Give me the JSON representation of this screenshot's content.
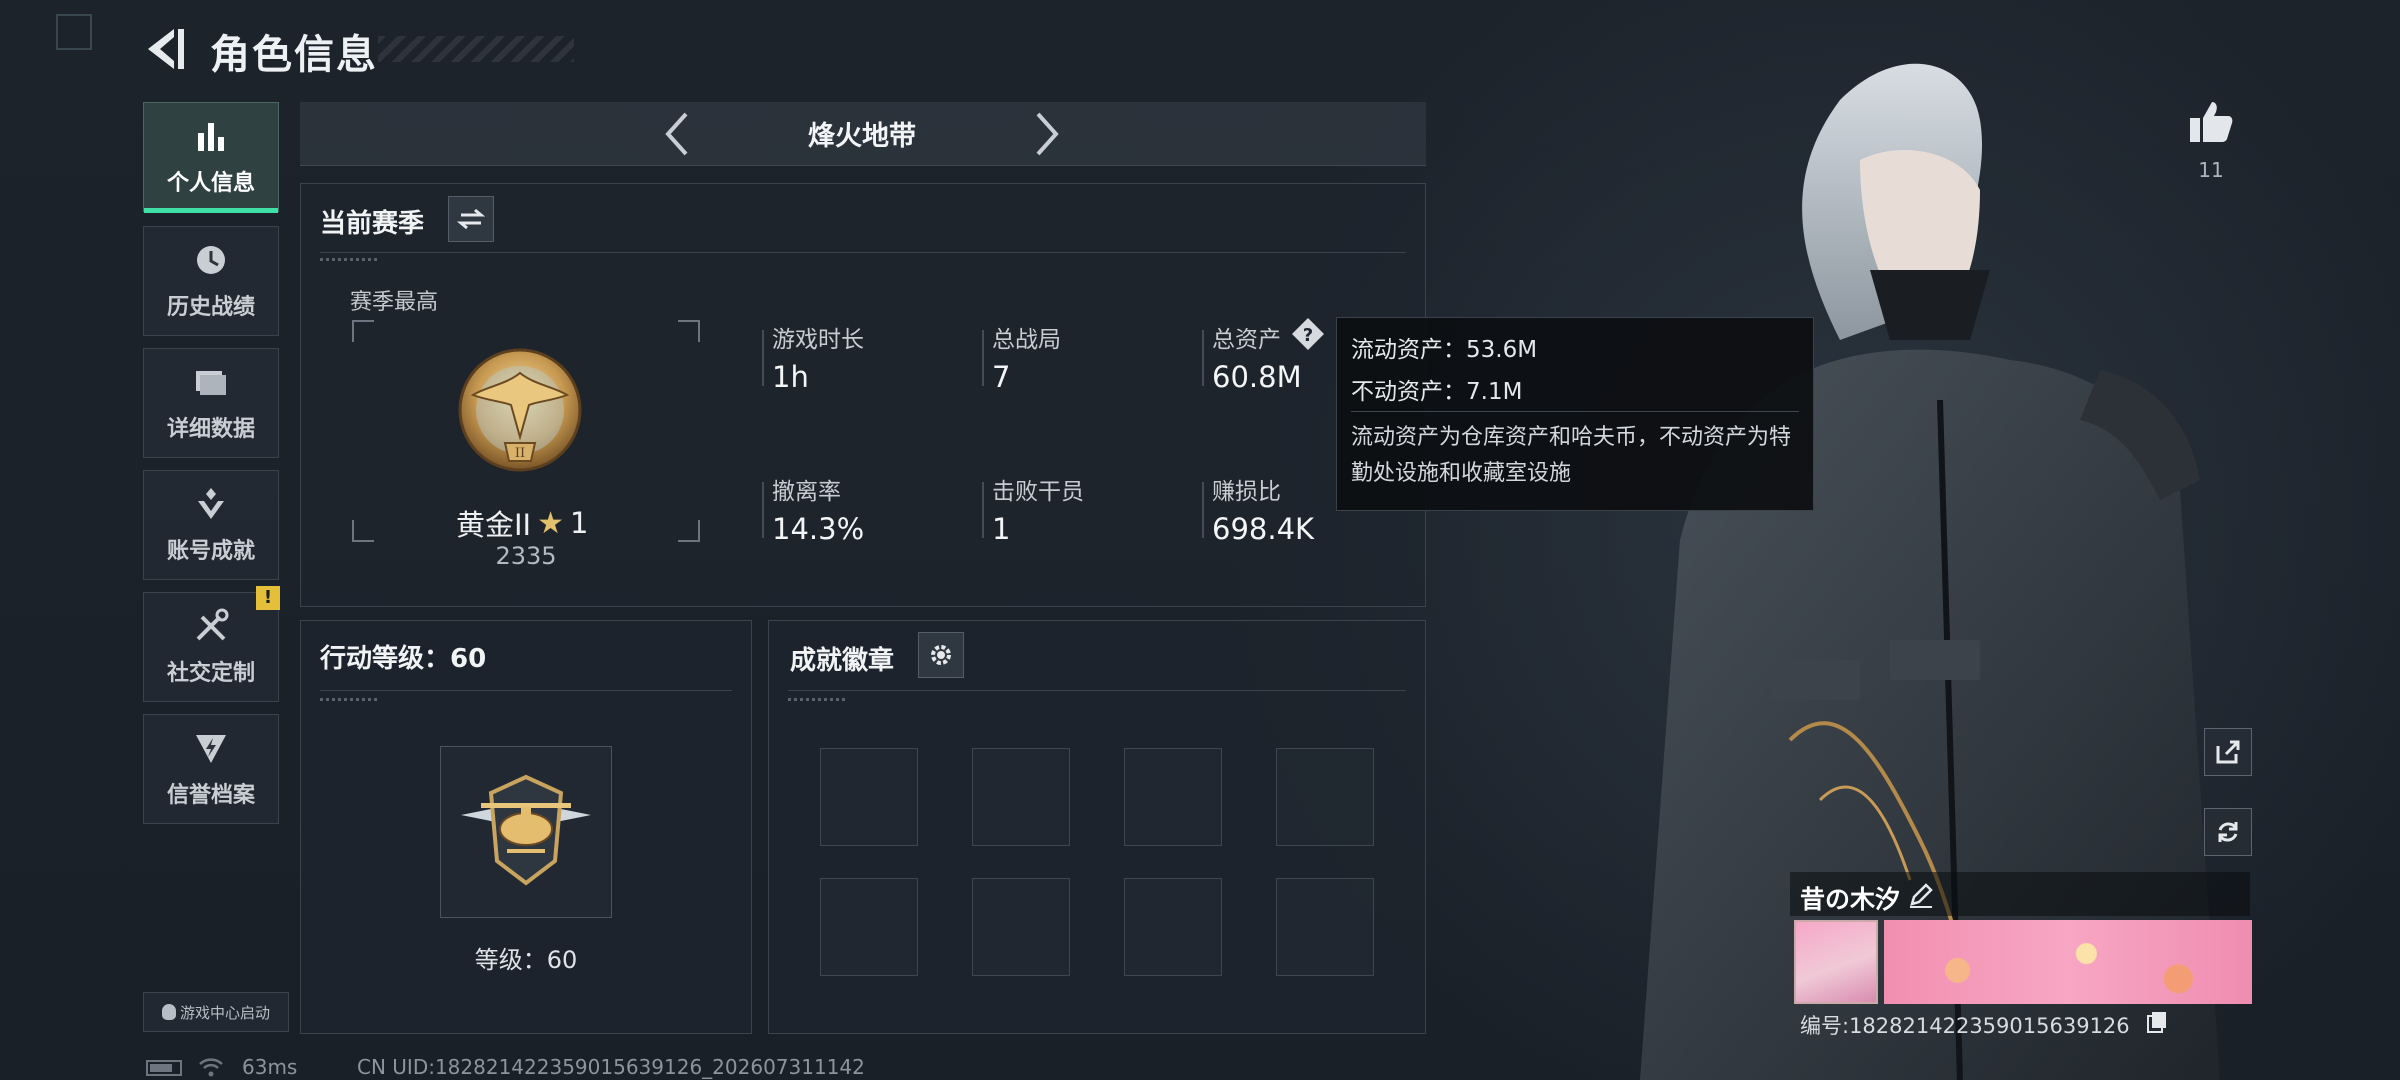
{
  "header": {
    "title": "角色信息"
  },
  "sidebar": {
    "items": [
      {
        "label": "个人信息",
        "icon": "bar-chart-icon",
        "active": true
      },
      {
        "label": "历史战绩",
        "icon": "clock-icon",
        "active": false
      },
      {
        "label": "详细数据",
        "icon": "folder-icon",
        "active": false
      },
      {
        "label": "账号成就",
        "icon": "achievement-icon",
        "active": false
      },
      {
        "label": "社交定制",
        "icon": "tools-icon",
        "active": false,
        "badge": "!"
      },
      {
        "label": "信誉档案",
        "icon": "shield-bolt-icon",
        "active": false
      }
    ],
    "game_center_label": "游戏中心启动"
  },
  "mode_selector": {
    "label": "烽火地带"
  },
  "season": {
    "title": "当前赛季",
    "highest_label": "赛季最高",
    "rank_name": "黄金II",
    "rank_stars": "1",
    "rank_score": "2335",
    "stats": [
      {
        "label": "游戏时长",
        "value": "1h"
      },
      {
        "label": "总战局",
        "value": "7"
      },
      {
        "label": "总资产",
        "value": "60.8M"
      },
      {
        "label": "撤离率",
        "value": "14.3%"
      },
      {
        "label": "击败干员",
        "value": "1"
      },
      {
        "label": "赚损比",
        "value": "698.4K"
      }
    ]
  },
  "tooltip": {
    "liquid": "流动资产：53.6M",
    "fixed": "不动资产：7.1M",
    "description": "流动资产为仓库资产和哈夫币，不动资产为特勤处设施和收藏室设施"
  },
  "level": {
    "title": "行动等级：60",
    "level_label": "等级：60"
  },
  "achievements": {
    "title": "成就徽章",
    "slot_count": 8
  },
  "profile": {
    "likes": "11",
    "player_name": "昔の木汐",
    "player_id": "编号:1828214223590156391​26"
  },
  "status_bar": {
    "ping": "63ms",
    "uid": "CN UID:1828214223590156391​26_202607311142"
  },
  "colors": {
    "accent": "#3ee0a8",
    "warning": "#e3bf3a",
    "background": "#1b2129"
  }
}
